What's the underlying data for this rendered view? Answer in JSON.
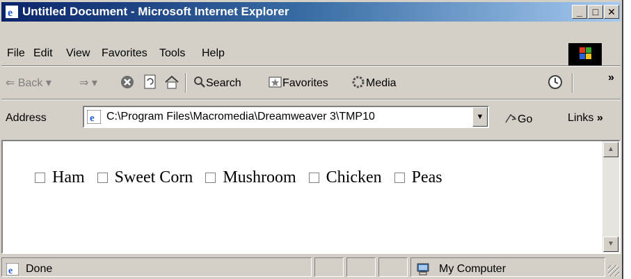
{
  "window": {
    "title": "Untitled Document - Microsoft Internet Explorer",
    "controls": {
      "minimize": "_",
      "maximize": "□",
      "close": "✕"
    }
  },
  "menu": [
    "File",
    "Edit",
    "View",
    "Favorites",
    "Tools",
    "Help"
  ],
  "toolbar": {
    "back": "Back",
    "search": "Search",
    "favorites": "Favorites",
    "media": "Media",
    "more": "»"
  },
  "address": {
    "label": "Address",
    "value": "C:\\Program Files\\Macromedia\\Dreamweaver 3\\TMP10",
    "go": "Go",
    "links": "Links",
    "links_more": "»"
  },
  "content": {
    "checkboxes": [
      {
        "label": "Ham",
        "checked": false
      },
      {
        "label": "Sweet Corn",
        "checked": false
      },
      {
        "label": "Mushroom",
        "checked": false
      },
      {
        "label": "Chicken",
        "checked": false
      },
      {
        "label": "Peas",
        "checked": false
      }
    ]
  },
  "status": {
    "text": "Done",
    "zone": "My Computer"
  },
  "colors": {
    "titlebar_start": "#0a246a",
    "titlebar_end": "#a6caf0",
    "chrome": "#d4d0c8",
    "background": "#ccffff"
  }
}
